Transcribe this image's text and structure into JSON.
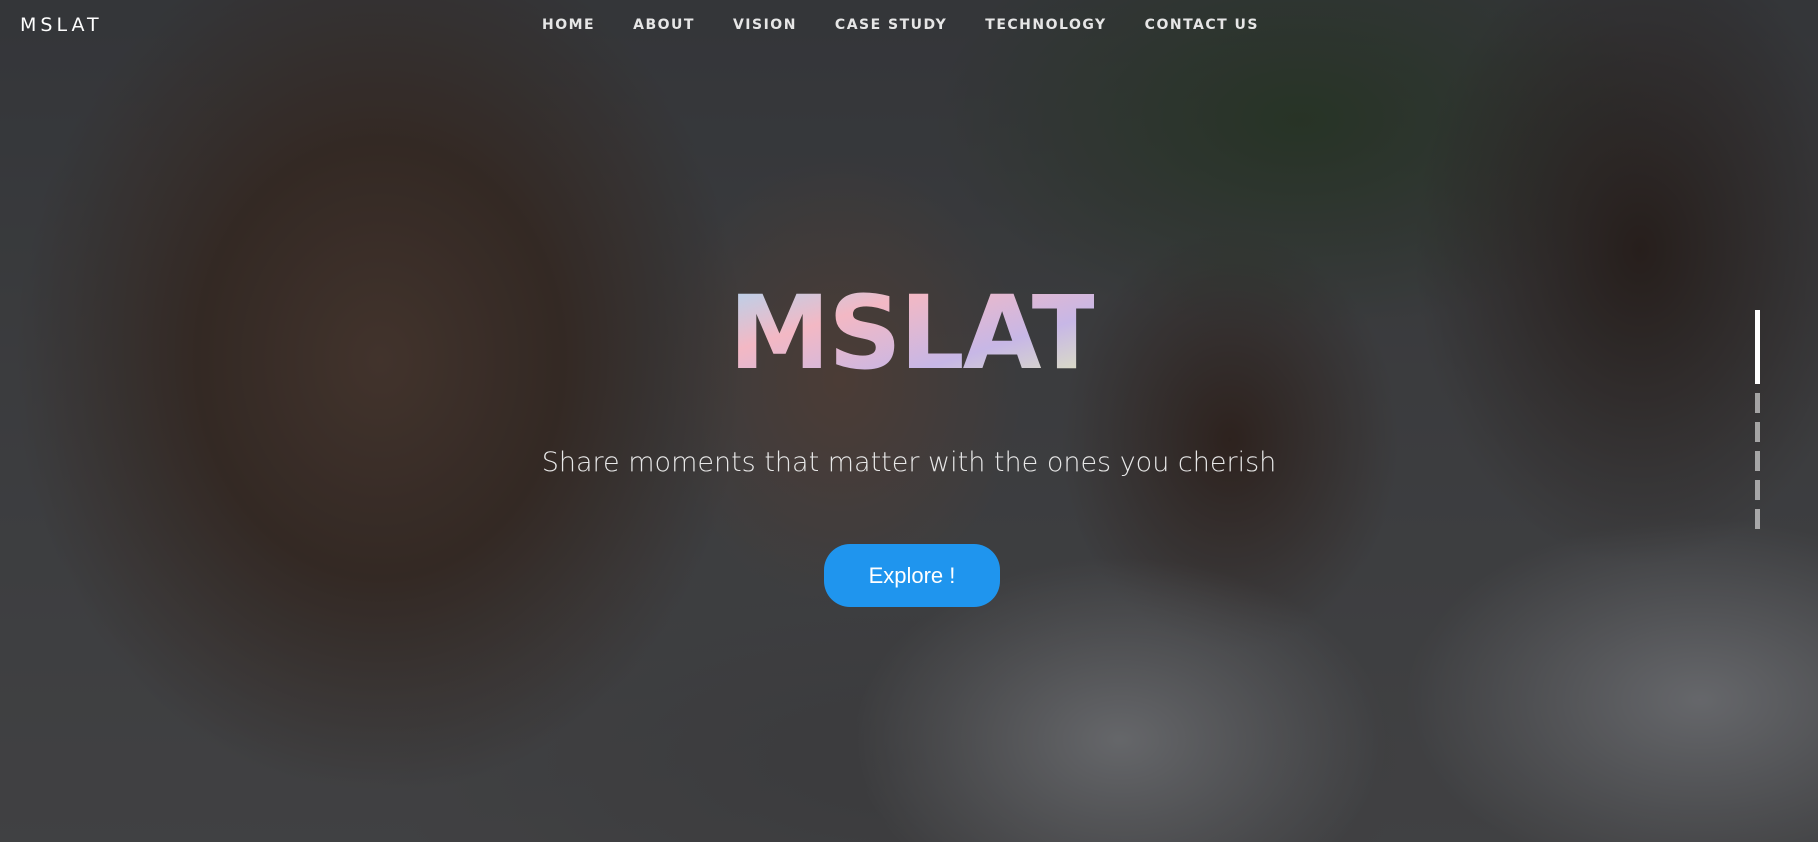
{
  "site": {
    "brand": "MSLAT"
  },
  "nav": {
    "items": [
      {
        "label": "HOME"
      },
      {
        "label": "ABOUT"
      },
      {
        "label": "VISION"
      },
      {
        "label": "CASE STUDY"
      },
      {
        "label": "TECHNOLOGY"
      },
      {
        "label": "CONTACT US"
      }
    ]
  },
  "hero": {
    "logo_text": "MSLAT",
    "tagline": "Share moments that matter with the ones you cherish",
    "cta_label": "Explore !",
    "cta_color": "#1f95ee",
    "logo_colors": [
      "#a9d8f5",
      "#f3b8c4",
      "#c7b7e6",
      "#e5f0b4"
    ]
  },
  "pager": {
    "total": 6,
    "active_index": 0
  }
}
